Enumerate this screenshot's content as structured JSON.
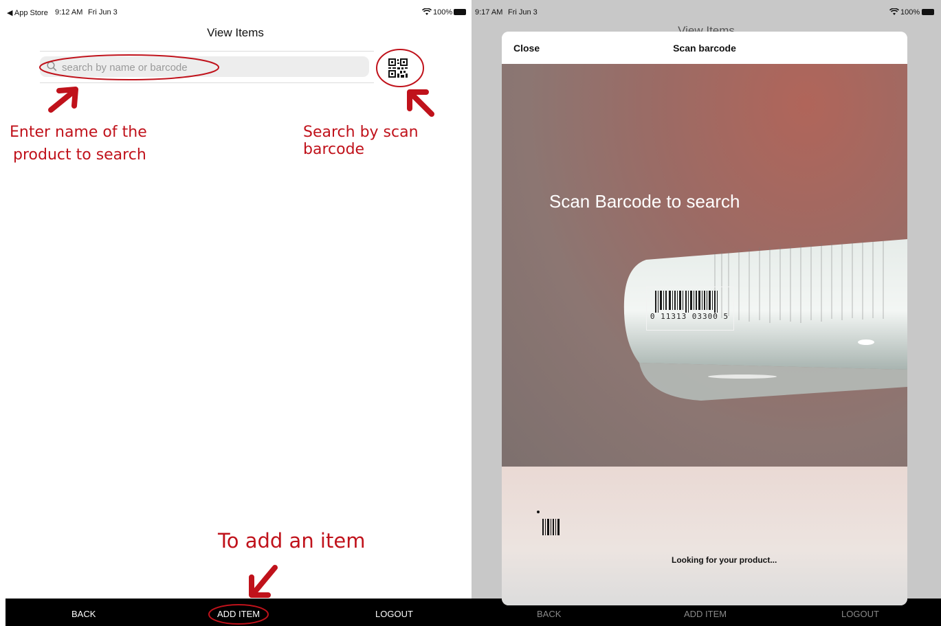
{
  "left": {
    "status": {
      "back_label": "◀ App Store",
      "time": "9:12 AM",
      "date": "Fri Jun 3",
      "battery": "100%"
    },
    "title": "View Items",
    "search": {
      "placeholder": "search by name or barcode",
      "value": ""
    },
    "icons": {
      "search": "search-icon",
      "qr": "qr-code-icon",
      "wifi": "wifi-icon",
      "battery": "battery-icon"
    },
    "annotations": {
      "search_line1": "Enter name of the",
      "search_line2": "product to search",
      "scan": "Search by scan barcode",
      "add": "To add an item"
    },
    "tabbar": {
      "back": "BACK",
      "add": "ADD ITEM",
      "logout": "LOGOUT"
    }
  },
  "right": {
    "status": {
      "time": "9:17 AM",
      "date": "Fri Jun 3",
      "battery": "100%"
    },
    "background_title": "View Items",
    "modal": {
      "close_label": "Close",
      "title": "Scan barcode",
      "overlay_text": "Scan Barcode to search",
      "barcode_number": "0  11313  03300  5",
      "status_text": "Looking for your product..."
    },
    "tabbar": {
      "back": "BACK",
      "add": "ADD ITEM",
      "logout": "LOGOUT"
    }
  },
  "colors": {
    "annotation": "#c0121b",
    "tabbar": "#000000",
    "modal_bg": "#ffffff",
    "dim_bg": "#c8c8c8"
  }
}
